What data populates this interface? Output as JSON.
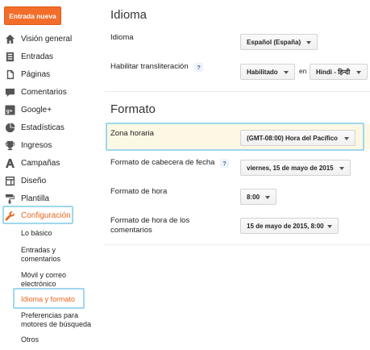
{
  "sidebar": {
    "new_post_label": "Entrada nueva",
    "items": [
      {
        "label": "Visión general",
        "icon": "home-icon"
      },
      {
        "label": "Entradas",
        "icon": "posts-icon"
      },
      {
        "label": "Páginas",
        "icon": "pages-icon"
      },
      {
        "label": "Comentarios",
        "icon": "comments-icon"
      },
      {
        "label": "Google+",
        "icon": "google-plus-icon"
      },
      {
        "label": "Estadísticas",
        "icon": "stats-pie-icon"
      },
      {
        "label": "Ingresos",
        "icon": "trophy-icon"
      },
      {
        "label": "Campañas",
        "icon": "campaigns-icon"
      },
      {
        "label": "Diseño",
        "icon": "layout-icon"
      },
      {
        "label": "Plantilla",
        "icon": "paint-roller-icon"
      },
      {
        "label": "Configuración",
        "icon": "wrench-icon"
      }
    ],
    "sub_items": [
      {
        "line1": "Lo básico",
        "line2": ""
      },
      {
        "line1": "Entradas y",
        "line2": "comentarios"
      },
      {
        "line1": "Móvil y correo",
        "line2": "electrónico"
      },
      {
        "line1": "Idioma y formato",
        "line2": ""
      },
      {
        "line1": "Preferencias para",
        "line2": "motores de búsqueda"
      },
      {
        "line1": "Otros",
        "line2": ""
      }
    ]
  },
  "idioma": {
    "section_title": "Idioma",
    "language_label": "Idioma",
    "language_value": "Español (España)",
    "translit_label": "Habilitar transliteración",
    "translit_value": "Habilitado",
    "en_text": "en",
    "translit_lang": "Hindi - हिन्दी"
  },
  "formato": {
    "section_title": "Formato",
    "timezone_label": "Zona horaria",
    "timezone_value": "(GMT-08:00) Hora del Pacífico",
    "header_date_label": "Formato de cabecera de fecha",
    "header_date_value": "viernes, 15 de mayo de 2015",
    "time_label": "Formato de hora",
    "time_value": "8:00",
    "comment_time_label_line1": "Formato de hora de los",
    "comment_time_label_line2": "comentarios",
    "comment_time_value": "15 de mayo de 2015, 8:00"
  },
  "help_mark": "?",
  "colors": {
    "accent": "#f36e2a",
    "highlight": "#9fd7ee",
    "row_highlight": "#fdf8e3"
  }
}
